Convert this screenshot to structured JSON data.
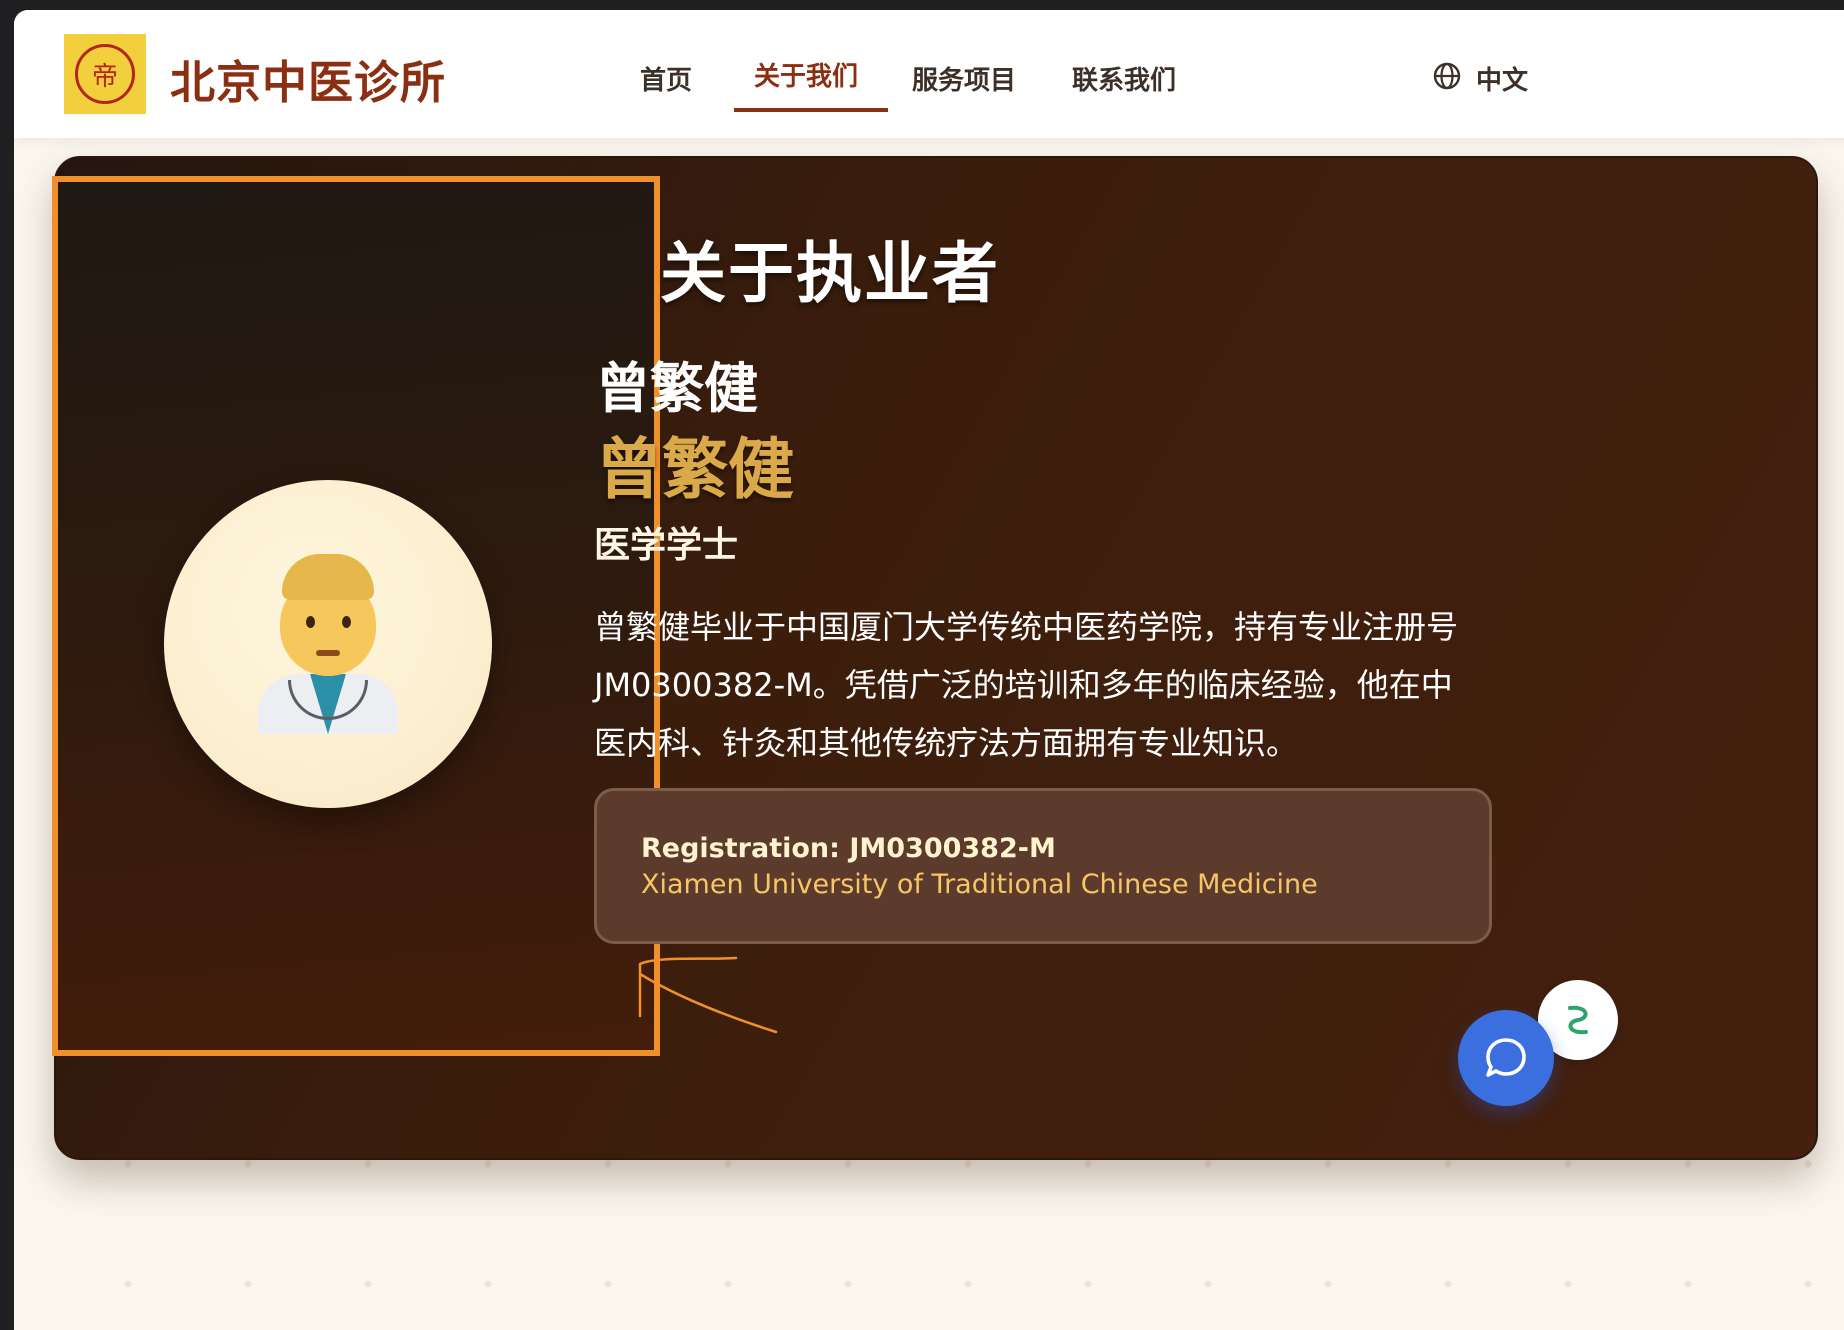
{
  "header": {
    "site_title": "北京中医诊所",
    "logo_mark": "帝",
    "nav": {
      "home": "首页",
      "about": "关于我们",
      "services": "服务项目",
      "contact": "联系我们"
    },
    "active_nav": "关于我们",
    "language_label": "中文",
    "language_icon": "globe-icon"
  },
  "about": {
    "section_title": "关于执业者",
    "name_primary": "曾繁健",
    "name_secondary": "曾繁健",
    "degree": "医学学士",
    "bio": "曾繁健毕业于中国厦门大学传统中医药学院，持有专业注册号JM0300382-M。凭借广泛的培训和多年的临床经验，他在中医内科、针灸和其他传统疗法方面拥有专业知识。",
    "avatar_icon": "doctor-emoji",
    "registration_line": "Registration: JM0300382-M",
    "institution_line": "Xiamen University of Traditional Chinese Medicine"
  },
  "widgets": {
    "chat_icon": "chat-bubble-icon"
  },
  "colors": {
    "brand": "#8a2f12",
    "accent_orange": "#f0902a",
    "gold": "#d9a94a",
    "chat_blue": "#3b6fe0"
  }
}
